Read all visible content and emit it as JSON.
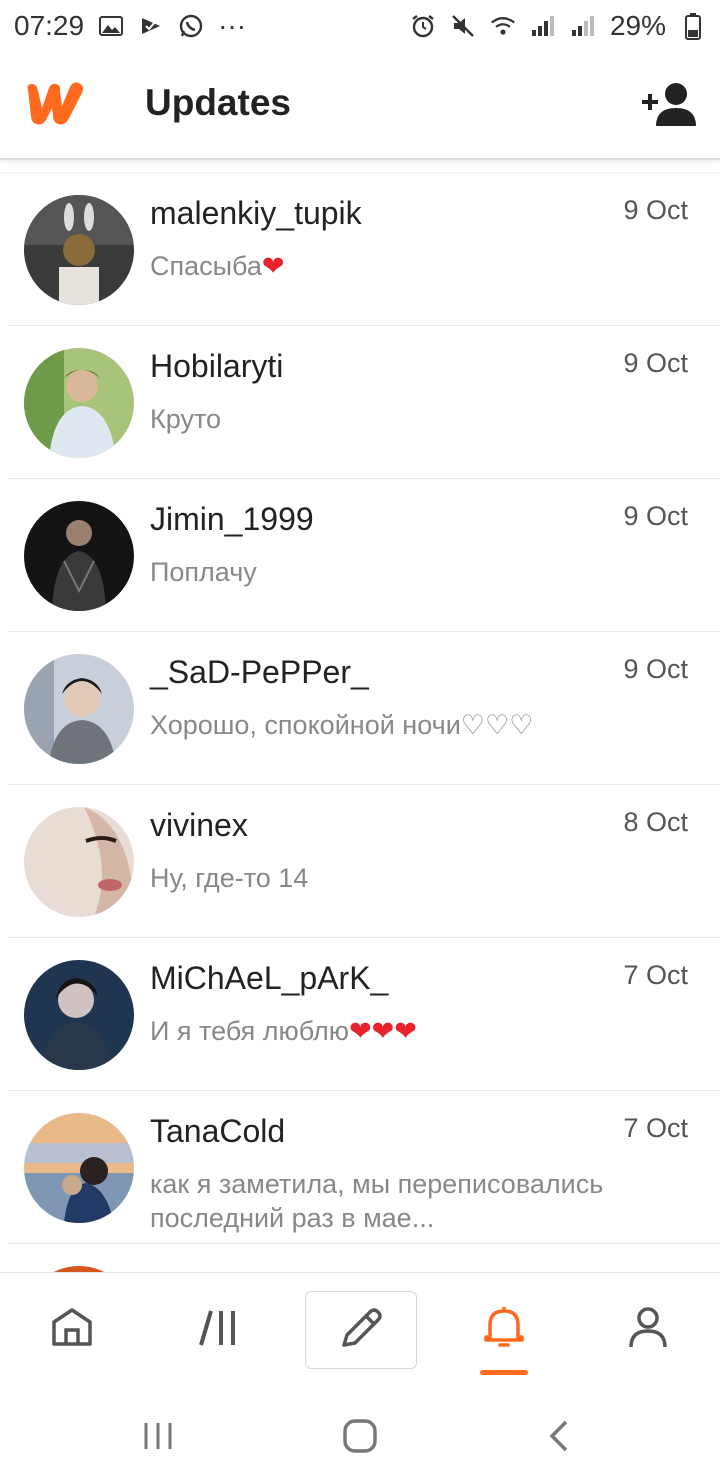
{
  "status_bar": {
    "time": "07:29",
    "battery": "29%",
    "overflow": "···"
  },
  "header": {
    "title": "Updates"
  },
  "colors": {
    "accent": "#FF6A1F",
    "heart": "#E8232E"
  },
  "messages": [
    {
      "name": "malenkiy_tupik",
      "date": "9 Oct",
      "text": "Спасыба",
      "hearts": "❤"
    },
    {
      "name": "Hobilaryti",
      "date": "9 Oct",
      "text": "Круто",
      "hearts": ""
    },
    {
      "name": "Jimin_1999",
      "date": "9 Oct",
      "text": "Поплачу",
      "hearts": ""
    },
    {
      "name": "_SaD-PePPer_",
      "date": "9 Oct",
      "text": "Хорошо, спокойной ночи♡♡♡",
      "hearts": ""
    },
    {
      "name": "vivinex",
      "date": "8 Oct",
      "text": "Ну, где-то 14",
      "hearts": ""
    },
    {
      "name": "MiChAeL_pArK_",
      "date": "7 Oct",
      "text": "И я тебя люблю",
      "hearts": "❤❤❤"
    },
    {
      "name": "TanaCold",
      "date": "7 Oct",
      "text": "как я заметила, мы переписовались последний раз в мае...",
      "hearts": ""
    }
  ],
  "nav": {
    "home": "home-icon",
    "library": "library-icon",
    "write": "pencil-icon",
    "updates": "bell-icon",
    "profile": "person-icon"
  }
}
